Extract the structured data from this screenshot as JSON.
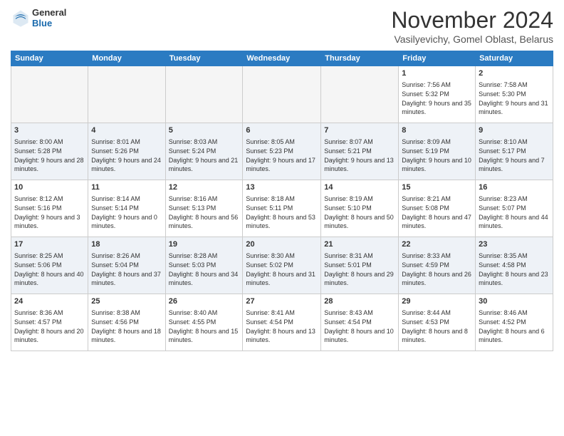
{
  "header": {
    "logo": {
      "general": "General",
      "blue": "Blue"
    },
    "title": "November 2024",
    "location": "Vasilyevichy, Gomel Oblast, Belarus"
  },
  "calendar": {
    "days_of_week": [
      "Sunday",
      "Monday",
      "Tuesday",
      "Wednesday",
      "Thursday",
      "Friday",
      "Saturday"
    ],
    "weeks": [
      [
        {
          "day": "",
          "content": ""
        },
        {
          "day": "",
          "content": ""
        },
        {
          "day": "",
          "content": ""
        },
        {
          "day": "",
          "content": ""
        },
        {
          "day": "",
          "content": ""
        },
        {
          "day": "1",
          "content": "Sunrise: 7:56 AM\nSunset: 5:32 PM\nDaylight: 9 hours and 35 minutes."
        },
        {
          "day": "2",
          "content": "Sunrise: 7:58 AM\nSunset: 5:30 PM\nDaylight: 9 hours and 31 minutes."
        }
      ],
      [
        {
          "day": "3",
          "content": "Sunrise: 8:00 AM\nSunset: 5:28 PM\nDaylight: 9 hours and 28 minutes."
        },
        {
          "day": "4",
          "content": "Sunrise: 8:01 AM\nSunset: 5:26 PM\nDaylight: 9 hours and 24 minutes."
        },
        {
          "day": "5",
          "content": "Sunrise: 8:03 AM\nSunset: 5:24 PM\nDaylight: 9 hours and 21 minutes."
        },
        {
          "day": "6",
          "content": "Sunrise: 8:05 AM\nSunset: 5:23 PM\nDaylight: 9 hours and 17 minutes."
        },
        {
          "day": "7",
          "content": "Sunrise: 8:07 AM\nSunset: 5:21 PM\nDaylight: 9 hours and 13 minutes."
        },
        {
          "day": "8",
          "content": "Sunrise: 8:09 AM\nSunset: 5:19 PM\nDaylight: 9 hours and 10 minutes."
        },
        {
          "day": "9",
          "content": "Sunrise: 8:10 AM\nSunset: 5:17 PM\nDaylight: 9 hours and 7 minutes."
        }
      ],
      [
        {
          "day": "10",
          "content": "Sunrise: 8:12 AM\nSunset: 5:16 PM\nDaylight: 9 hours and 3 minutes."
        },
        {
          "day": "11",
          "content": "Sunrise: 8:14 AM\nSunset: 5:14 PM\nDaylight: 9 hours and 0 minutes."
        },
        {
          "day": "12",
          "content": "Sunrise: 8:16 AM\nSunset: 5:13 PM\nDaylight: 8 hours and 56 minutes."
        },
        {
          "day": "13",
          "content": "Sunrise: 8:18 AM\nSunset: 5:11 PM\nDaylight: 8 hours and 53 minutes."
        },
        {
          "day": "14",
          "content": "Sunrise: 8:19 AM\nSunset: 5:10 PM\nDaylight: 8 hours and 50 minutes."
        },
        {
          "day": "15",
          "content": "Sunrise: 8:21 AM\nSunset: 5:08 PM\nDaylight: 8 hours and 47 minutes."
        },
        {
          "day": "16",
          "content": "Sunrise: 8:23 AM\nSunset: 5:07 PM\nDaylight: 8 hours and 44 minutes."
        }
      ],
      [
        {
          "day": "17",
          "content": "Sunrise: 8:25 AM\nSunset: 5:06 PM\nDaylight: 8 hours and 40 minutes."
        },
        {
          "day": "18",
          "content": "Sunrise: 8:26 AM\nSunset: 5:04 PM\nDaylight: 8 hours and 37 minutes."
        },
        {
          "day": "19",
          "content": "Sunrise: 8:28 AM\nSunset: 5:03 PM\nDaylight: 8 hours and 34 minutes."
        },
        {
          "day": "20",
          "content": "Sunrise: 8:30 AM\nSunset: 5:02 PM\nDaylight: 8 hours and 31 minutes."
        },
        {
          "day": "21",
          "content": "Sunrise: 8:31 AM\nSunset: 5:01 PM\nDaylight: 8 hours and 29 minutes."
        },
        {
          "day": "22",
          "content": "Sunrise: 8:33 AM\nSunset: 4:59 PM\nDaylight: 8 hours and 26 minutes."
        },
        {
          "day": "23",
          "content": "Sunrise: 8:35 AM\nSunset: 4:58 PM\nDaylight: 8 hours and 23 minutes."
        }
      ],
      [
        {
          "day": "24",
          "content": "Sunrise: 8:36 AM\nSunset: 4:57 PM\nDaylight: 8 hours and 20 minutes."
        },
        {
          "day": "25",
          "content": "Sunrise: 8:38 AM\nSunset: 4:56 PM\nDaylight: 8 hours and 18 minutes."
        },
        {
          "day": "26",
          "content": "Sunrise: 8:40 AM\nSunset: 4:55 PM\nDaylight: 8 hours and 15 minutes."
        },
        {
          "day": "27",
          "content": "Sunrise: 8:41 AM\nSunset: 4:54 PM\nDaylight: 8 hours and 13 minutes."
        },
        {
          "day": "28",
          "content": "Sunrise: 8:43 AM\nSunset: 4:54 PM\nDaylight: 8 hours and 10 minutes."
        },
        {
          "day": "29",
          "content": "Sunrise: 8:44 AM\nSunset: 4:53 PM\nDaylight: 8 hours and 8 minutes."
        },
        {
          "day": "30",
          "content": "Sunrise: 8:46 AM\nSunset: 4:52 PM\nDaylight: 8 hours and 6 minutes."
        }
      ]
    ]
  }
}
